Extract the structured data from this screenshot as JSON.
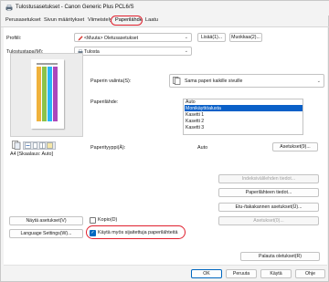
{
  "window": {
    "title": "Tulostusasetukset - Canon Generic Plus PCL6/S"
  },
  "tabs": [
    {
      "label": "Perusasetukset"
    },
    {
      "label": "Sivun määritykset"
    },
    {
      "label": "Viimeistely"
    },
    {
      "label": "Paperilähde"
    },
    {
      "label": "Laatu"
    }
  ],
  "profile": {
    "label": "Profiili:",
    "value": "<Muuta> Oletusasetukset",
    "add_button": "Lisää(1)...",
    "edit_button": "Muokkaa(2)..."
  },
  "output": {
    "label": "Tulostustapa(M):",
    "value": "Tulosta"
  },
  "preview": {
    "caption": "A4 [Skaalaus: Auto]"
  },
  "paper_selection": {
    "label": "Paperin valinta(S):",
    "value": "Sama paperi kaikille sivuille"
  },
  "paper_source": {
    "label": "Paperilähde:",
    "options": [
      "Auto",
      "Monikäyttöalusta",
      "Kasetti 1",
      "Kasetti 2",
      "Kasetti 3"
    ],
    "selected": "Monikäyttöalusta"
  },
  "paper_type": {
    "label": "Paperityyppi(Ä):",
    "value": "Auto",
    "settings_button": "Asetukset(9)..."
  },
  "side_buttons": {
    "tray_info": "Indeksivälilehden tiedot...",
    "paper_info": "Paperilähteen tiedot...",
    "tray_settings": "Etu-/takakannen asetukset(Ü)...",
    "settings": "Asetukset(0)..."
  },
  "left_buttons": {
    "show_settings": "Näytä asetukset(V)",
    "language": "Language Settings(W)..."
  },
  "checkboxes": {
    "copies": {
      "label": "Kopio(D)",
      "checked": false
    },
    "mixed_paper": {
      "label": "Käytä myös sijaitettuja paperilähteitä",
      "checked": true
    }
  },
  "footer": {
    "restore_defaults": "Palauta oletukset(R)",
    "ok": "OK",
    "cancel": "Peruuta",
    "apply": "Käytä",
    "help": "Ohje"
  },
  "colors": {
    "accent": "#0067c0",
    "selection": "#0a60c8",
    "highlight_ring": "#e0202e"
  }
}
